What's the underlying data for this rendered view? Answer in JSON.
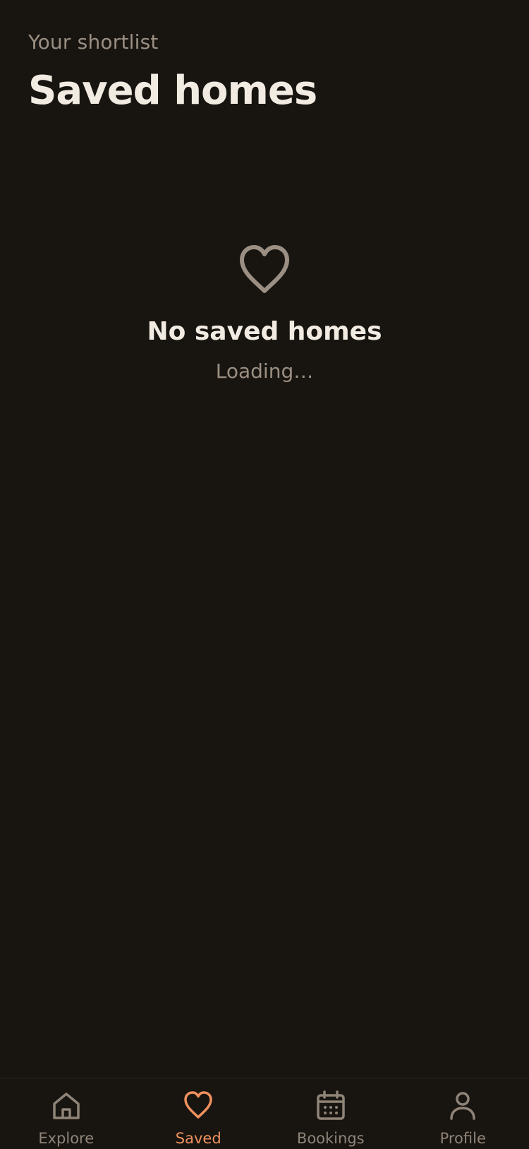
{
  "header": {
    "eyebrow": "Your shortlist",
    "title": "Saved homes"
  },
  "empty_state": {
    "icon": "heart-outline-icon",
    "title": "No saved homes",
    "subtitle": "Loading…"
  },
  "tabbar": {
    "active": "saved",
    "tabs": [
      {
        "id": "explore",
        "label": "Explore",
        "icon": "home-icon"
      },
      {
        "id": "saved",
        "label": "Saved",
        "icon": "heart-icon"
      },
      {
        "id": "bookings",
        "label": "Bookings",
        "icon": "calendar-icon"
      },
      {
        "id": "profile",
        "label": "Profile",
        "icon": "person-icon"
      }
    ]
  },
  "colors": {
    "background": "#181511",
    "text_primary": "#f2ebe2",
    "text_muted": "#9a8f82",
    "accent": "#f0915e",
    "tab_inactive": "#8f8477"
  }
}
